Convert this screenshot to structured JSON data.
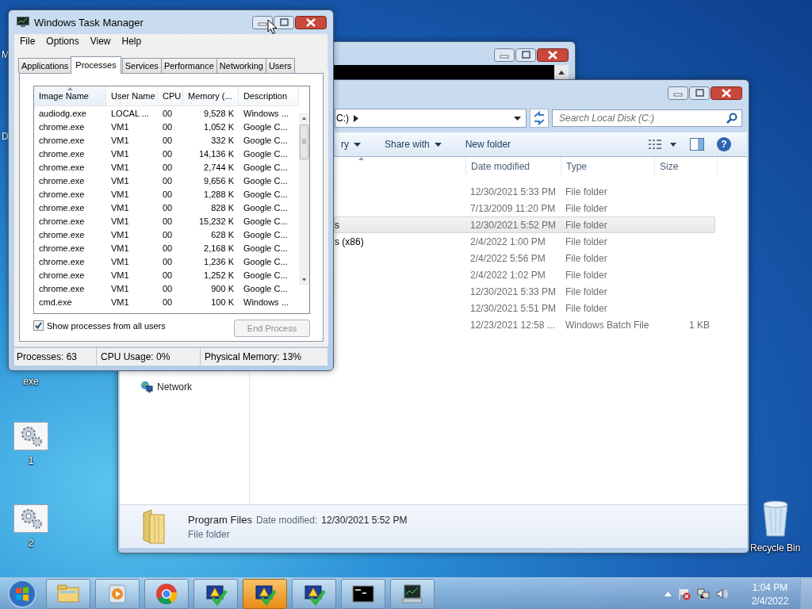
{
  "desktop": {
    "edge_labels": [
      "M",
      "D"
    ],
    "icons": [
      {
        "kind": "none",
        "label": "exe"
      },
      {
        "kind": "gear",
        "label": "1"
      },
      {
        "kind": "gear",
        "label": "2"
      },
      {
        "kind": "recycle",
        "label": "Recycle Bin"
      }
    ]
  },
  "explorer": {
    "address": "C:)",
    "search": {
      "placeholder": "Search Local Disk (C:)"
    },
    "toolbar": [
      {
        "label": "ry",
        "menu": true
      },
      {
        "label": "Share with",
        "menu": true
      },
      {
        "label": "New folder",
        "menu": false
      }
    ],
    "columns": [
      "Date modified",
      "Type",
      "Size"
    ],
    "rows": [
      {
        "name": "",
        "date": "12/30/2021 5:33 PM",
        "type": "File folder",
        "size": "",
        "selected": false
      },
      {
        "name": "",
        "date": "7/13/2009 11:20 PM",
        "type": "File folder",
        "size": "",
        "selected": false
      },
      {
        "name": "s",
        "date": "12/30/2021 5:52 PM",
        "type": "File folder",
        "size": "",
        "selected": true
      },
      {
        "name": "s (x86)",
        "date": "2/4/2022 1:00 PM",
        "type": "File folder",
        "size": "",
        "selected": false
      },
      {
        "name": "",
        "date": "2/4/2022 5:56 PM",
        "type": "File folder",
        "size": "",
        "selected": false
      },
      {
        "name": "",
        "date": "2/4/2022 1:02 PM",
        "type": "File folder",
        "size": "",
        "selected": false
      },
      {
        "name": "",
        "date": "12/30/2021 5:33 PM",
        "type": "File folder",
        "size": "",
        "selected": false
      },
      {
        "name": "",
        "date": "12/30/2021 5:51 PM",
        "type": "File folder",
        "size": "",
        "selected": false
      },
      {
        "name": "",
        "date": "12/23/2021 12:58 ...",
        "type": "Windows Batch File",
        "size": "1 KB",
        "selected": false
      }
    ],
    "help": "?",
    "nav": [
      "Network"
    ],
    "details": {
      "name": "Program Files",
      "date_label": "Date modified:",
      "date": "12/30/2021 5:52 PM",
      "type": "File folder"
    }
  },
  "task_manager": {
    "title": "Windows Task Manager",
    "menu": [
      "File",
      "Options",
      "View",
      "Help"
    ],
    "tabs": [
      {
        "label": "Applications",
        "selected": false
      },
      {
        "label": "Processes",
        "selected": true
      },
      {
        "label": "Services",
        "selected": false
      },
      {
        "label": "Performance",
        "selected": false
      },
      {
        "label": "Networking",
        "selected": false
      },
      {
        "label": "Users",
        "selected": false
      }
    ],
    "columns": [
      "Image Name",
      "User Name",
      "CPU",
      "Memory (...",
      "Description"
    ],
    "rows": [
      [
        "audiodg.exe",
        "LOCAL ...",
        "00",
        "9,528 K",
        "Windows ..."
      ],
      [
        "chrome.exe",
        "VM1",
        "00",
        "1,052 K",
        "Google C..."
      ],
      [
        "chrome.exe",
        "VM1",
        "00",
        "332 K",
        "Google C..."
      ],
      [
        "chrome.exe",
        "VM1",
        "00",
        "14,136 K",
        "Google C..."
      ],
      [
        "chrome.exe",
        "VM1",
        "00",
        "2,744 K",
        "Google C..."
      ],
      [
        "chrome.exe",
        "VM1",
        "00",
        "9,656 K",
        "Google C..."
      ],
      [
        "chrome.exe",
        "VM1",
        "00",
        "1,288 K",
        "Google C..."
      ],
      [
        "chrome.exe",
        "VM1",
        "00",
        "828 K",
        "Google C..."
      ],
      [
        "chrome.exe",
        "VM1",
        "00",
        "15,232 K",
        "Google C..."
      ],
      [
        "chrome.exe",
        "VM1",
        "00",
        "628 K",
        "Google C..."
      ],
      [
        "chrome.exe",
        "VM1",
        "00",
        "2,168 K",
        "Google C..."
      ],
      [
        "chrome.exe",
        "VM1",
        "00",
        "1,236 K",
        "Google C..."
      ],
      [
        "chrome.exe",
        "VM1",
        "00",
        "1,252 K",
        "Google C..."
      ],
      [
        "chrome.exe",
        "VM1",
        "00",
        "900 K",
        "Google C..."
      ],
      [
        "cmd.exe",
        "VM1",
        "00",
        "100 K",
        "Windows ..."
      ]
    ],
    "show_all": {
      "label": "Show processes from all users",
      "checked": true
    },
    "end_process": {
      "label": "End Process",
      "disabled": true
    },
    "status": [
      "Processes: 63",
      "CPU Usage: 0%",
      "Physical Memory: 13%"
    ]
  },
  "taskbar": {
    "items": [
      {
        "kind": "explorer",
        "selected": false
      },
      {
        "kind": "media",
        "selected": false
      },
      {
        "kind": "chrome",
        "selected": false
      },
      {
        "kind": "shield",
        "selected": false
      },
      {
        "kind": "shield",
        "selected": true
      },
      {
        "kind": "shield",
        "selected": false
      },
      {
        "kind": "console",
        "selected": false
      },
      {
        "kind": "monitor",
        "selected": false
      }
    ],
    "time": "1:04 PM",
    "date": "2/4/2022"
  }
}
